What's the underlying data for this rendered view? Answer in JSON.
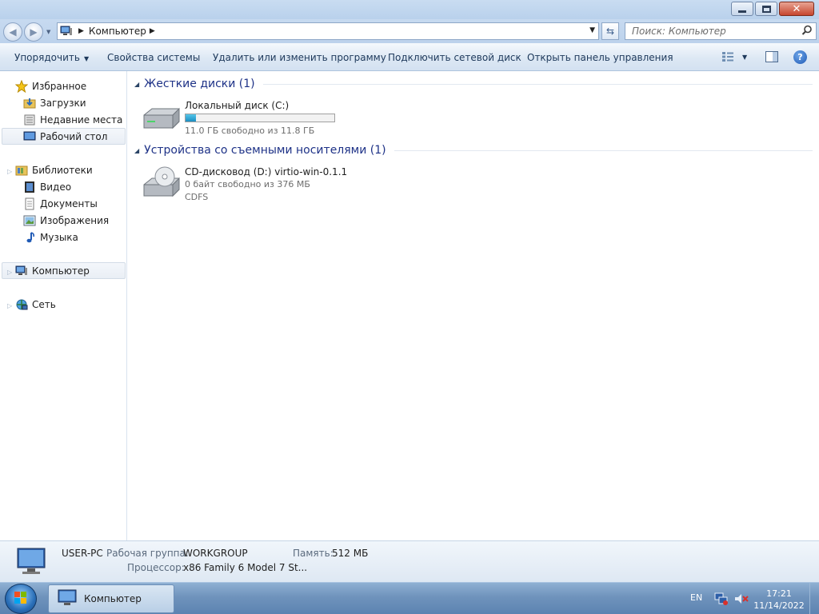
{
  "window": {
    "titlebar_buttons": [
      "minimize-icon",
      "maximize-icon",
      "close-icon"
    ],
    "close_glyph": "✕"
  },
  "address": {
    "location": "Компьютер",
    "search_placeholder": "Поиск: Компьютер"
  },
  "commands": {
    "organize": "Упорядочить",
    "system_properties": "Свойства системы",
    "uninstall": "Удалить или изменить программу",
    "map_drive": "Подключить сетевой диск",
    "control_panel": "Открыть панель управления"
  },
  "nav": {
    "favorites": "Избранное",
    "downloads": "Загрузки",
    "recent": "Недавние места",
    "desktop": "Рабочий стол",
    "libraries": "Библиотеки",
    "video": "Видео",
    "documents": "Документы",
    "pictures": "Изображения",
    "music": "Музыка",
    "computer": "Компьютер",
    "network": "Сеть"
  },
  "groups": {
    "hard_disks": "Жесткие диски (1)",
    "removable": "Устройства со съемными носителями (1)"
  },
  "drives": {
    "c": {
      "name": "Локальный диск (C:)",
      "free": "11.0 ГБ свободно из 11.8 ГБ",
      "used_fraction": 0.068
    },
    "d": {
      "name": "CD-дисковод (D:) virtio-win-0.1.1",
      "free": "0 байт свободно из 376 МБ",
      "fs": "CDFS"
    }
  },
  "details": {
    "computer_name": "USER-PC",
    "workgroup_label": "Рабочая группа:",
    "workgroup_value": "WORKGROUP",
    "memory_label": "Память:",
    "memory_value": "512 МБ",
    "cpu_label": "Процессор:",
    "cpu_value": "x86 Family 6 Model 7 St..."
  },
  "taskbar": {
    "task_label": "Компьютер",
    "lang": "EN",
    "time": "17:21",
    "date": "11/14/2022"
  },
  "colors": {
    "accent": "#1e3287",
    "usage_bar": "#1b8ec2",
    "taskbar": "#6f93bc"
  }
}
